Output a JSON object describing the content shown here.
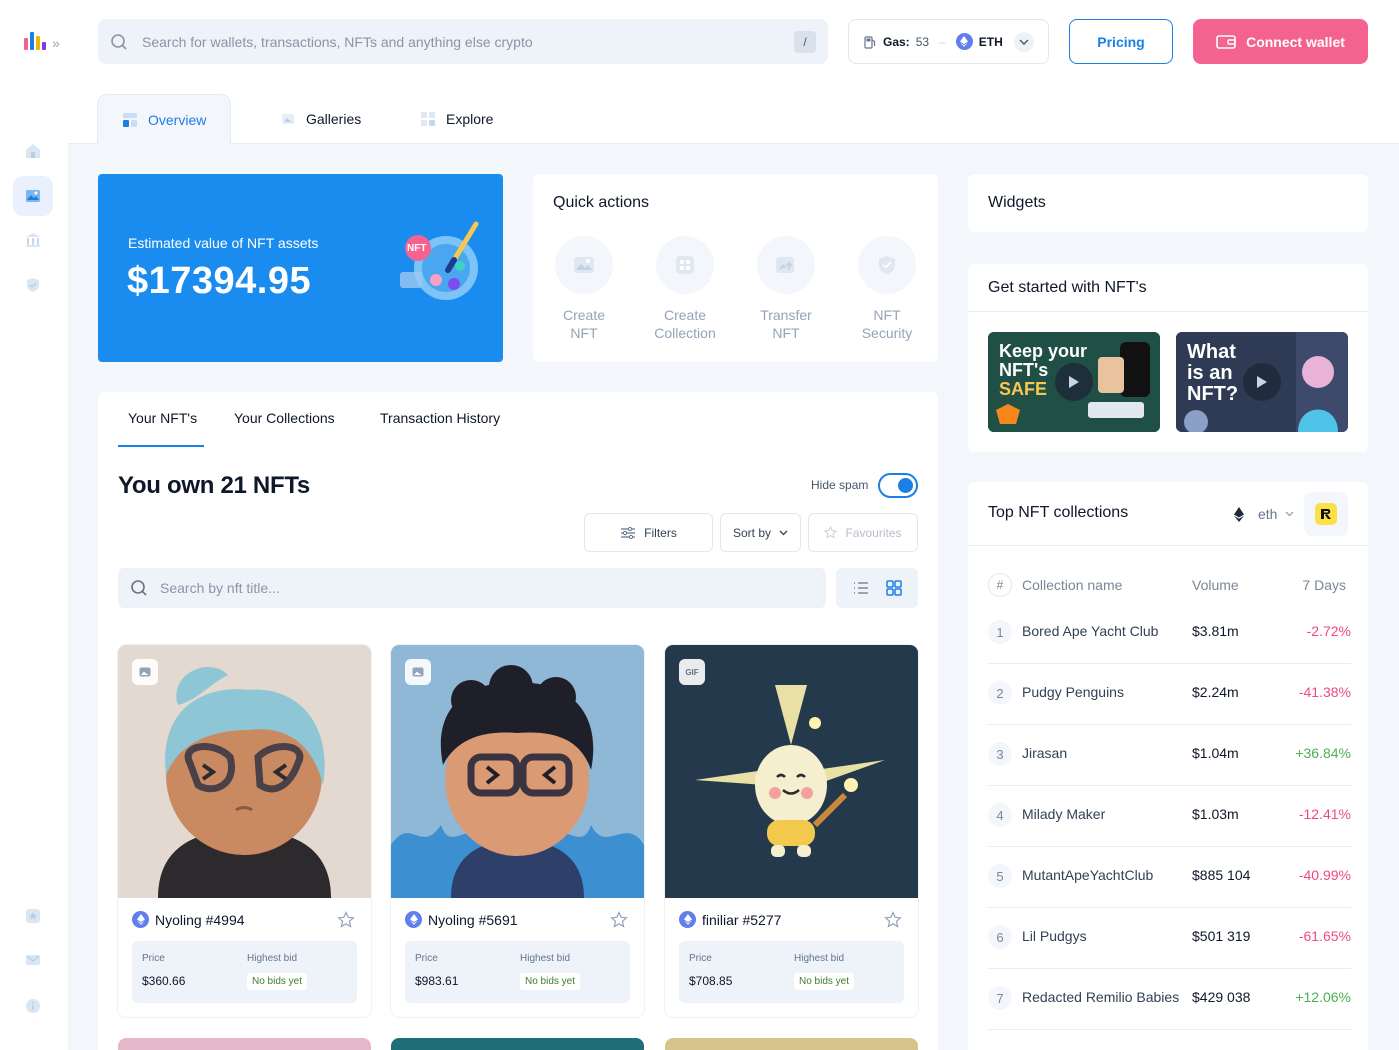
{
  "header": {
    "search_placeholder": "Search for wallets, transactions, NFTs and anything else crypto",
    "search_shortcut": "/",
    "gas_label": "Gas:",
    "gas_value": "53",
    "gas_separator": "–",
    "network": "ETH",
    "pricing_label": "Pricing",
    "connect_label": "Connect wallet"
  },
  "tabs": [
    {
      "label": "Overview",
      "active": true
    },
    {
      "label": "Galleries",
      "active": false
    },
    {
      "label": "Explore",
      "active": false
    }
  ],
  "hero": {
    "label": "Estimated value of NFT assets",
    "value": "$17394.95",
    "badge_text": "NFT"
  },
  "quick_actions": {
    "title": "Quick actions",
    "items": [
      {
        "line1": "Create",
        "line2": "NFT",
        "icon": "image-icon"
      },
      {
        "line1": "Create",
        "line2": "Collection",
        "icon": "grid-icon"
      },
      {
        "line1": "Transfer",
        "line2": "NFT",
        "icon": "transfer-image-icon"
      },
      {
        "line1": "NFT",
        "line2": "Security",
        "icon": "shield-icon"
      }
    ]
  },
  "nft_section": {
    "tabs": [
      "Your NFT's",
      "Your Collections",
      "Transaction History"
    ],
    "count_title": "You own 21 NFTs",
    "hide_spam_label": "Hide spam",
    "hide_spam_on": true,
    "filters_label": "Filters",
    "sortby_label": "Sort by",
    "favourites_label": "Favourites",
    "search_placeholder": "Search by nft title...",
    "price_label": "Price",
    "highest_bid_label": "Highest bid",
    "cards": [
      {
        "name": "Nyoling #4994",
        "price": "$360.66",
        "bid": "No bids yet",
        "badge": "IMG"
      },
      {
        "name": "Nyoling #5691",
        "price": "$983.61",
        "bid": "No bids yet",
        "badge": "IMG"
      },
      {
        "name": "finiliar #5277",
        "price": "$708.85",
        "bid": "No bids yet",
        "badge": "GIF"
      }
    ]
  },
  "widgets": {
    "title": "Widgets"
  },
  "get_started": {
    "title": "Get started with NFT's",
    "videos": [
      {
        "line1": "Keep your",
        "line2": "NFT's",
        "line3": "SAFE"
      },
      {
        "line1": "What",
        "line2": "is an",
        "line3": "NFT?"
      }
    ]
  },
  "top_collections": {
    "title": "Top NFT collections",
    "network": "eth",
    "headers": {
      "rank": "#",
      "name": "Collection name",
      "volume": "Volume",
      "change": "7 Days"
    },
    "rows": [
      {
        "rank": "1",
        "name": "Bored Ape Yacht Club",
        "volume": "$3.81m",
        "change": "-2.72%",
        "positive": false
      },
      {
        "rank": "2",
        "name": "Pudgy Penguins",
        "volume": "$2.24m",
        "change": "-41.38%",
        "positive": false
      },
      {
        "rank": "3",
        "name": "Jirasan",
        "volume": "$1.04m",
        "change": "+36.84%",
        "positive": true
      },
      {
        "rank": "4",
        "name": "Milady Maker",
        "volume": "$1.03m",
        "change": "-12.41%",
        "positive": false
      },
      {
        "rank": "5",
        "name": "MutantApeYachtClub",
        "volume": "$885 104",
        "change": "-40.99%",
        "positive": false
      },
      {
        "rank": "6",
        "name": "Lil Pudgys",
        "volume": "$501 319",
        "change": "-61.65%",
        "positive": false
      },
      {
        "rank": "7",
        "name": "Redacted Remilio Babies",
        "volume": "$429 038",
        "change": "+12.06%",
        "positive": true
      }
    ]
  },
  "colors": {
    "accent": "#1b7fe6",
    "connect": "#f4628f",
    "positive": "#4caf50",
    "negative": "#ef4a7a"
  }
}
